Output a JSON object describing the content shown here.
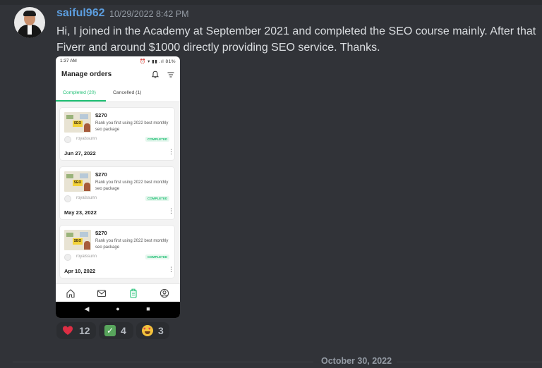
{
  "message": {
    "username": "saiful962",
    "timestamp": "10/29/2022 8:42 PM",
    "text_line1": "Hi, I joined in the Academy at September 2021 and completed the SEO course mainly. After that",
    "text_line2": "Fiverr and around $1000 directly providing SEO service. Thanks."
  },
  "phone": {
    "status_time": "1:37 AM",
    "status_icons": "⏰ ▾ ▮▮ .ıl 81%",
    "title": "Manage orders",
    "tabs": [
      {
        "label": "Completed (20)",
        "active": true
      },
      {
        "label": "Cancelled (1)",
        "active": false
      }
    ],
    "orders": [
      {
        "price": "$270",
        "gig": "Rank you first using 2022 best monthly seo package",
        "seller": "royalssunn",
        "status": "COMPLETED",
        "date": "Jun 27, 2022",
        "thumb_text": "SEO"
      },
      {
        "price": "$270",
        "gig": "Rank you first using 2022 best monthly seo package",
        "seller": "royalssunn",
        "status": "COMPLETED",
        "date": "May 23, 2022",
        "thumb_text": "SEO"
      },
      {
        "price": "$270",
        "gig": "Rank you first using 2022 best monthly seo package",
        "seller": "royalssunn",
        "status": "COMPLETED",
        "date": "Apr 10, 2022",
        "thumb_text": "SEO"
      }
    ],
    "more_glyph": "⋮",
    "sysnav": {
      "back": "◀",
      "home": "●",
      "recents": "■"
    }
  },
  "reactions": [
    {
      "emoji": "red-heart",
      "count": "12"
    },
    {
      "emoji": "check-mark",
      "count": "4"
    },
    {
      "emoji": "heart-eyes",
      "count": "3"
    }
  ],
  "date_divider": "October 30, 2022",
  "colors": {
    "username": "#5c9ee0",
    "fiverr_green": "#1dbf73",
    "background": "#313338"
  }
}
